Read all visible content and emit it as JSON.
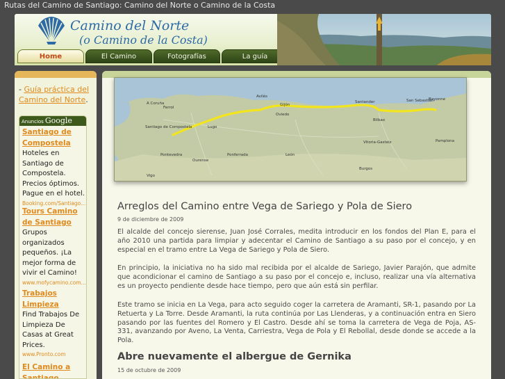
{
  "window": {
    "title": "Rutas del Camino de Santiago: Camino del Norte o Camino de la Costa"
  },
  "logo": {
    "line1": "Camino del Norte",
    "line2": "(o Camino de la Costa)"
  },
  "nav": {
    "items": [
      {
        "label": "Home",
        "active": true
      },
      {
        "label": "El Camino",
        "active": false
      },
      {
        "label": "Fotografías",
        "active": false
      },
      {
        "label": "La guía",
        "active": false
      }
    ]
  },
  "sidebar": {
    "guide_prefix": "- ",
    "guide_link": "Guía práctica del Camino del Norte",
    "guide_suffix": ".",
    "ads_label": "Anuncios",
    "ads_brand": "Google",
    "ads": [
      {
        "title": "Santiago de Compostela",
        "body": "Hoteles en Santiago de Compostela. Precios óptimos. Pague en el hotel.",
        "url": "Booking.com/Santiago..."
      },
      {
        "title": "Tours Camino de Santiago",
        "body": "Grupos organizados pequeños. ¡La mejor forma de vivir el Camino!",
        "url": "www.mofycamino.com..."
      },
      {
        "title": "Trabajos Limpieza",
        "body": "Find Trabajos De Limpieza De Casas at Great Prices.",
        "url": "www.Pronto.com"
      },
      {
        "title": "El Camino a Santiago",
        "body": "",
        "url": ""
      }
    ]
  },
  "map": {
    "labels": [
      {
        "text": "A Coruña",
        "k": "c"
      },
      {
        "text": "Ferrol",
        "k": "f"
      },
      {
        "text": "Avilés",
        "k": "a"
      },
      {
        "text": "Gijón",
        "k": "g"
      },
      {
        "text": "Oviedo",
        "k": "o"
      },
      {
        "text": "Santander",
        "k": "s"
      },
      {
        "text": "San Sebastián",
        "k": "ss"
      },
      {
        "text": "Bilbao",
        "k": "b"
      },
      {
        "text": "Vitoria-Gasteiz",
        "k": "v"
      },
      {
        "text": "Pamplona",
        "k": "p"
      },
      {
        "text": "Bayonne",
        "k": "by"
      },
      {
        "text": "Santiago de Compostela",
        "k": "sc"
      },
      {
        "text": "Lugo",
        "k": "l"
      },
      {
        "text": "León",
        "k": "le"
      },
      {
        "text": "Burgos",
        "k": "bu"
      },
      {
        "text": "Ponferrada",
        "k": "po"
      },
      {
        "text": "Ourense",
        "k": "ou"
      },
      {
        "text": "Pontevedra",
        "k": "pv"
      },
      {
        "text": "Vigo",
        "k": "vi"
      }
    ]
  },
  "posts": [
    {
      "title": "Arreglos del Camino entre Vega de Sariego y Pola de Siero",
      "date": "9 de diciembre de 2009",
      "paragraphs": [
        "El alcalde del concejo sierense, Juan José Corrales, medita introducir en los fondos del Plan E, para el año 2010 una partida para limpiar y adecentar el Camino de Santiago a su paso por el concejo, y en especial en el tramo entre La Vega de Sariego y Pola de Siero.",
        "En principio, la iniciativa no ha sido mal recibida por el alcalde de Sariego, Javier Parajón, que admite que acondicionar el camino de Santiago a su paso por el concejo e, incluso, realizar una vía alternativa es un proyecto pendiente desde hace tiempo, pero que aún está sin perfilar.",
        "Este tramo se inicia en La Vega, para acto seguido coger la carretera de Aramanti, SR-1, pasando por La Retuerta y La Torre. Desde Aramanti, la ruta continúa por Las Llenderas, y a continuación entra en Siero pasando por las fuentes del Romero y El Castro. Desde ahí se toma la carretera de Vega de Poja, AS-331, avanzando por Aveno, La Venta, Carriestra, Vega de Pola y El Rebollal, desde donde se accede a la Pola."
      ]
    },
    {
      "title": "Abre nuevamente el albergue de Gernika",
      "date": "15 de octubre de 2009",
      "paragraphs": []
    }
  ]
}
